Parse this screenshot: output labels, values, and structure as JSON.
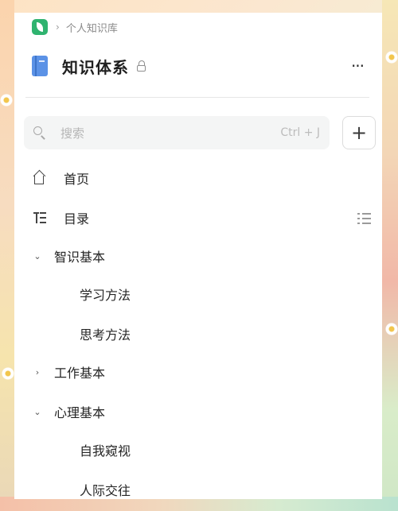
{
  "breadcrumb": {
    "separator": "›",
    "path": "个人知识库"
  },
  "header": {
    "title": "知识体系",
    "more_label": "···"
  },
  "search": {
    "placeholder": "搜索",
    "shortcut": "Ctrl + J",
    "add_label": "+"
  },
  "nav": [
    {
      "label": "首页",
      "icon": "home-icon"
    },
    {
      "label": "目录",
      "icon": "toc-icon"
    }
  ],
  "tree": [
    {
      "label": "智识基本",
      "expanded": true,
      "chevron": "⌄"
    },
    {
      "label": "学习方法",
      "leaf": true
    },
    {
      "label": "思考方法",
      "leaf": true
    },
    {
      "label": "工作基本",
      "expanded": false,
      "chevron": "›"
    },
    {
      "label": "心理基本",
      "expanded": true,
      "chevron": "⌄"
    },
    {
      "label": "自我窥视",
      "leaf": true
    },
    {
      "label": "人际交往",
      "leaf": true
    }
  ],
  "colors": {
    "accent_green": "#2fb36f",
    "book_blue": "#5b92e6"
  }
}
